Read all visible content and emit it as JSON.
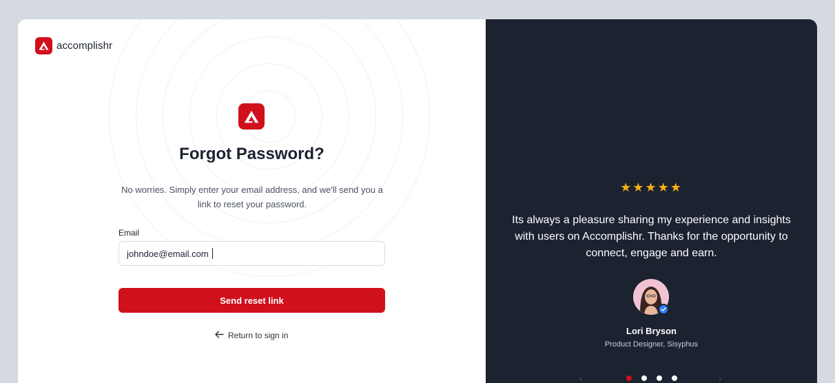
{
  "brand": {
    "name": "accomplishr",
    "logo_icon": "accomplishr-logo-icon",
    "accent_color": "#d0101c"
  },
  "form": {
    "title": "Forgot Password?",
    "subtitle": "No worries. Simply enter your email address, and we'll send you a link to reset your password.",
    "email_label": "Email",
    "email_value": "johndoe@email.com",
    "submit_label": "Send reset link",
    "return_label": "Return to sign in",
    "return_icon": "arrow-left-icon"
  },
  "testimonial": {
    "rating": 5,
    "stars": "★★★★★",
    "quote": "Its always a pleasure sharing my experience and insights with users on Accomplishr. Thanks for the opportunity to connect, engage and earn.",
    "name": "Lori Bryson",
    "role": "Product Designer, Sisyphus",
    "verified_icon": "verified-check-icon"
  },
  "carousel": {
    "prev_icon": "chevron-left-icon",
    "next_icon": "chevron-right-icon",
    "slide_count": 4,
    "active_index": 0
  },
  "colors": {
    "panel_dark": "#1b2230",
    "star": "#f5b014",
    "page_bg": "#d5d9e0"
  }
}
